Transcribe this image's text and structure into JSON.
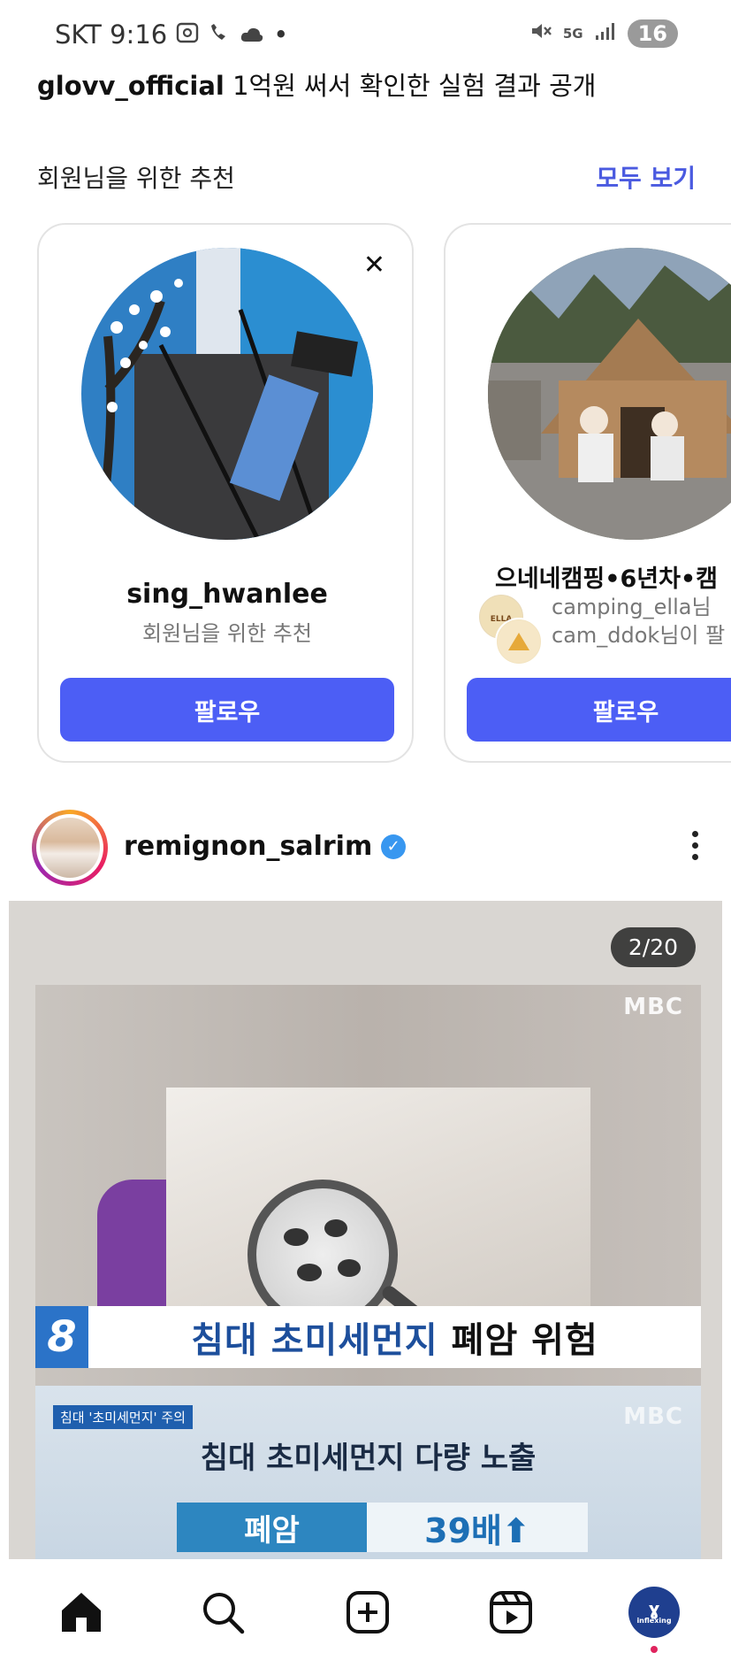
{
  "status_bar": {
    "carrier_time": "SKT 9:16",
    "network": "5G",
    "battery": "16"
  },
  "caption": {
    "user": "glovv_official",
    "text": "1억원 써서 확인한 실험 결과 공개"
  },
  "suggestions": {
    "title": "회원님을 위한 추천",
    "see_all": "모두 보기",
    "cards": [
      {
        "name": "sing_hwanlee",
        "subtitle": "회원님을 위한 추천",
        "follow": "팔로우"
      },
      {
        "name": "으네네캠핑•6년차•캠",
        "mutual_line1": "camping_ella님",
        "mutual_line2": "cam_ddok님이 팔",
        "follow": "팔로우"
      }
    ]
  },
  "post": {
    "username": "remignon_salrim",
    "counter": "2/20",
    "broadcaster": "MBC",
    "channel": "8",
    "headline1_blue": "침대 초미세먼지",
    "headline1_black": "폐암 위험",
    "small_tag": "침대 '초미세먼지' 주의",
    "headline2": "침대 초미세먼지 다량 노출",
    "stat_label": "폐암",
    "stat_value": "39배⬆"
  },
  "bottom_nav": {
    "profile_label": "inflexing"
  },
  "colors": {
    "accent": "#4c5ef5",
    "link": "#4a5ae0",
    "verified": "#3897f0"
  }
}
